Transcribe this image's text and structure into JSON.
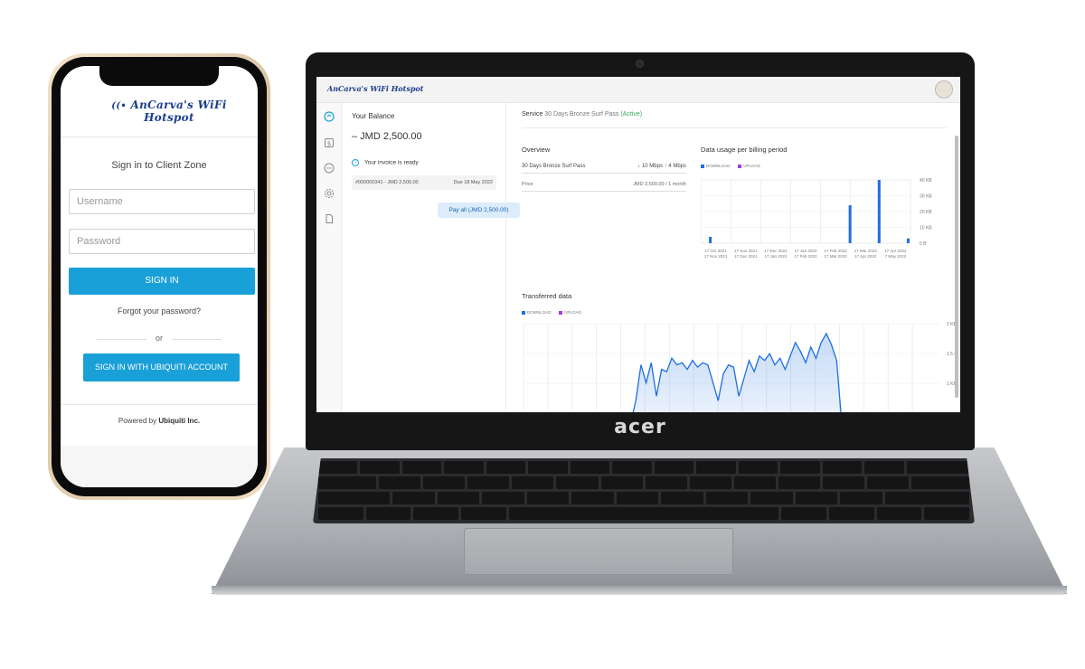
{
  "phone": {
    "logo": "AnCarva's WiFi Hotspot",
    "title": "Sign in to Client Zone",
    "username_placeholder": "Username",
    "password_placeholder": "Password",
    "sign_in_label": "SIGN IN",
    "forgot_label": "Forgot your password?",
    "or_label": "or",
    "ubiquiti_label": "SIGN IN WITH UBIQUITI ACCOUNT",
    "powered_prefix": "Powered by ",
    "powered_brand": "Ubiquiti Inc."
  },
  "laptop": {
    "brand": "acer",
    "logo": "AnCarva's WiFi Hotspot",
    "balance": {
      "label": "Your Balance",
      "amount": "– JMD 2,500.00",
      "invoice_notice": "Your invoice is ready",
      "invoice_ref": "#000000341 - JMD 2,500.00",
      "invoice_due": "Due 18 May 2022",
      "pay_label": "Pay all (JMD 2,500.00)"
    },
    "service": {
      "label": "Service",
      "name": "30 Days Bronze Surf Pass",
      "status": "(Active)"
    },
    "overview": {
      "title": "Overview",
      "plan": "30 Days Bronze Surf Pass",
      "speed": "↓ 10 Mbps ↑ 4 Mbps",
      "price_label": "Price",
      "price_value": "JMD 2,500.00 / 1 month"
    },
    "legend": {
      "download": "DOWNLOAD",
      "upload": "UPLOAD"
    },
    "colors": {
      "download": "#1e6fe0",
      "upload": "#a23bd6",
      "accent": "#1aa0d8"
    },
    "usage_title": "Data usage per billing period",
    "transferred_title": "Transferred data"
  },
  "chart_data": [
    {
      "type": "bar",
      "title": "Data usage per billing period",
      "categories": [
        "17 Oct 2021 17 Nov 2021",
        "17 Nov 2021 17 Dec 2021",
        "17 Dec 2021 17 Jan 2022",
        "17 Jan 2022 17 Feb 2022",
        "17 Feb 2022 17 Mar 2022",
        "17 Mar 2022 17 Apr 2022",
        "17 Apr 2022 7 May 2022"
      ],
      "series": [
        {
          "name": "DOWNLOAD",
          "values": [
            4,
            0,
            0,
            0,
            24,
            40,
            3
          ]
        },
        {
          "name": "UPLOAD",
          "values": [
            0,
            0,
            0,
            0,
            0,
            0,
            0
          ]
        }
      ],
      "yticks": [
        "40 KB",
        "30 KB",
        "20 KB",
        "10 KB",
        "0 B"
      ],
      "ylim": [
        0,
        40
      ]
    },
    {
      "type": "area",
      "title": "Transferred data",
      "series": [
        {
          "name": "DOWNLOAD",
          "values": [
            0,
            0,
            0,
            0,
            0,
            0,
            0.5,
            1.3,
            0.9,
            1.35,
            0.6,
            1.2,
            1.15,
            1.45,
            1.3,
            1.35,
            1.2,
            1.4,
            1.25,
            1.35,
            1.3,
            0.9,
            0.5,
            1.1,
            1.3,
            1.25,
            0.6,
            1.0,
            1.4,
            1.15,
            1.5,
            1.4,
            1.55,
            1.3,
            1.45,
            1.2,
            1.5,
            1.8,
            1.6,
            1.35,
            1.7,
            1.45,
            1.8,
            2.0,
            1.75,
            1.4,
            0
          ]
        }
      ],
      "yticks": [
        "2 KB",
        "1.5 KB",
        "1 KB"
      ],
      "ylim": [
        0,
        2
      ]
    }
  ]
}
